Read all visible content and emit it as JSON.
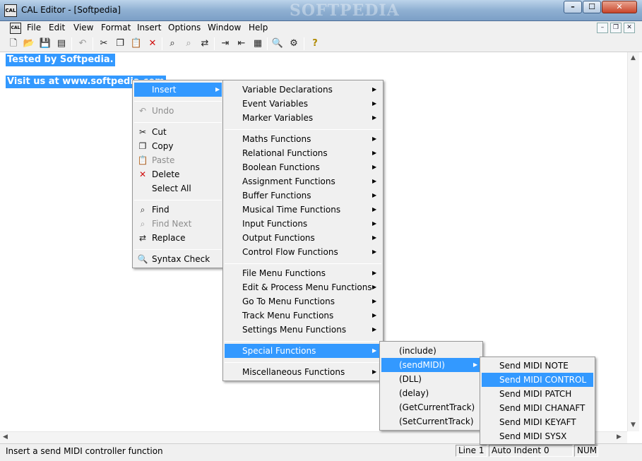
{
  "window": {
    "title": "CAL Editor - [Softpedia]",
    "app_icon_text": "CAL",
    "watermark": "SOFTPEDIA",
    "min_glyph": "–",
    "max_glyph": "☐",
    "close_glyph": "✕"
  },
  "menubar": {
    "items": [
      "File",
      "Edit",
      "View",
      "Format",
      "Insert",
      "Options",
      "Window",
      "Help"
    ],
    "mdi_min": "–",
    "mdi_restore": "❐",
    "mdi_close": "✕"
  },
  "editor": {
    "lines": [
      "Tested by Softpedia.",
      "Visit us at www.softpedia.com"
    ]
  },
  "context_menu": {
    "insert": "Insert",
    "undo": "Undo",
    "cut": "Cut",
    "copy": "Copy",
    "paste": "Paste",
    "delete": "Delete",
    "select_all": "Select All",
    "find": "Find",
    "find_next": "Find Next",
    "replace": "Replace",
    "syntax_check": "Syntax Check"
  },
  "insert_submenu": {
    "items": [
      "Variable Declarations",
      "Event Variables",
      "Marker Variables",
      "Maths Functions",
      "Relational Functions",
      "Boolean Functions",
      "Assignment Functions",
      "Buffer Functions",
      "Musical Time Functions",
      "Input Functions",
      "Output Functions",
      "Control Flow Functions",
      "File Menu Functions",
      "Edit & Process Menu Functions",
      "Go To Menu Functions",
      "Track Menu Functions",
      "Settings Menu Functions",
      "Special Functions",
      "Miscellaneous Functions"
    ]
  },
  "special_submenu": {
    "items": [
      "(include)",
      "(sendMIDI)",
      "(DLL)",
      "(delay)",
      "(GetCurrentTrack)",
      "(SetCurrentTrack)"
    ]
  },
  "sendmidi_submenu": {
    "items": [
      "Send MIDI NOTE",
      "Send MIDI CONTROL",
      "Send MIDI PATCH",
      "Send MIDI CHANAFT",
      "Send MIDI KEYAFT",
      "Send MIDI SYSX"
    ]
  },
  "statusbar": {
    "message": "Insert a send MIDI controller function",
    "line": "Line 1",
    "auto_indent": "Auto Indent 0",
    "num": "NUM"
  },
  "colors": {
    "highlight": "#3399ff",
    "menu_bg": "#f0f0f0"
  }
}
